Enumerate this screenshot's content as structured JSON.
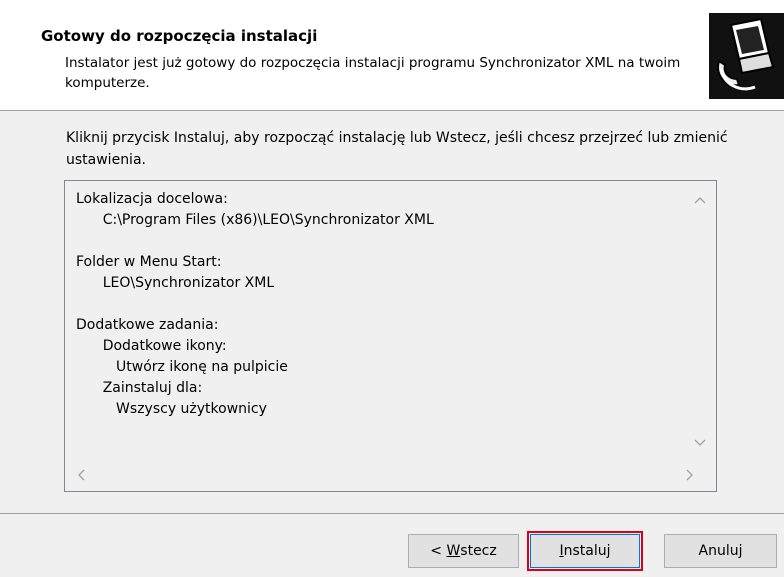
{
  "header": {
    "title": "Gotowy do rozpoczęcia instalacji",
    "description": "Instalator jest już gotowy do rozpoczęcia instalacji programu Synchronizator XML na twoim komputerze."
  },
  "instruction": "Kliknij przycisk Instaluj, aby rozpocząć instalację lub Wstecz, jeśli chcesz przejrzeć lub zmienić ustawienia.",
  "memo": {
    "lines": [
      "Lokalizacja docelowa:",
      "      C:\\Program Files (x86)\\LEO\\Synchronizator XML",
      "",
      "Folder w Menu Start:",
      "      LEO\\Synchronizator XML",
      "",
      "Dodatkowe zadania:",
      "      Dodatkowe ikony:",
      "         Utwórz ikonę na pulpicie",
      "      Zainstaluj dla:",
      "         Wszyscy użytkownicy"
    ]
  },
  "buttons": {
    "back_underlined": "W",
    "back_prefix": "< ",
    "back_rest": "stecz",
    "install_underlined": "I",
    "install_rest": "nstaluj",
    "cancel": "Anuluj"
  },
  "icons": {
    "scroll_up": "chevron-up-icon",
    "scroll_down": "chevron-down-icon",
    "scroll_left": "chevron-left-icon",
    "scroll_right": "chevron-right-icon",
    "logo": "installer-logo-icon"
  },
  "colors": {
    "highlight": "#d9001b",
    "header_bg": "#ffffff",
    "dialog_bg": "#f0f0f0"
  }
}
